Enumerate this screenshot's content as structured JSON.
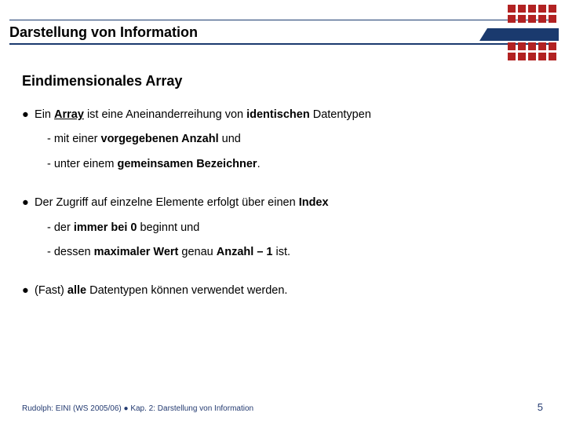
{
  "header": {
    "title": "Darstellung von Information"
  },
  "subtitle": "Eindimensionales Array",
  "body": {
    "b1": {
      "pre": "Ein ",
      "array": "Array",
      "mid": " ist eine Aneinanderreihung von ",
      "ident": "identischen",
      "tail": " Datentypen"
    },
    "b1a": {
      "pre": "- mit einer ",
      "vor": "vorgegebenen Anzahl",
      "tail": " und"
    },
    "b1b": {
      "pre": "- unter einem ",
      "gem": "gemeinsamen Bezeichner",
      "tail": "."
    },
    "b2": {
      "pre": "Der Zugriff auf einzelne Elemente erfolgt über einen ",
      "idx": "Index"
    },
    "b2a": {
      "pre": "- der ",
      "immer": "immer bei 0",
      "tail": " beginnt und"
    },
    "b2b": {
      "pre": "- dessen ",
      "max": "maximaler Wert",
      "mid": " genau ",
      "anz": "Anzahl – 1",
      "tail": " ist."
    },
    "b3": {
      "pre": "(Fast) ",
      "alle": "alle",
      "tail": " Datentypen können verwendet werden."
    }
  },
  "footer": {
    "left": "Rudolph: EINI (WS 2005/06)  ●  Kap. 2: Darstellung von Information",
    "page": "5"
  },
  "glyph": {
    "bullet": "●"
  }
}
